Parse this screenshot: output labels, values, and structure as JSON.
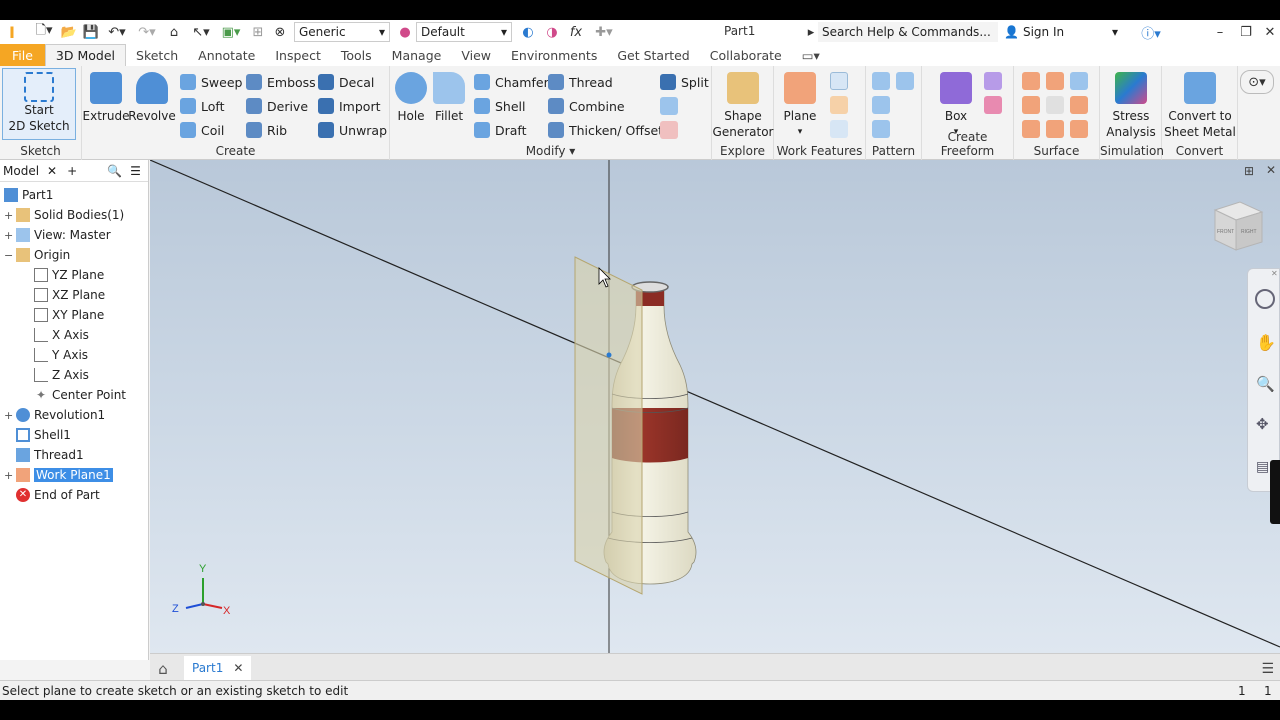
{
  "quick_access": {
    "material_value": "Generic",
    "appearance_value": "Default",
    "document_title": "Part1",
    "search_placeholder": "Search Help & Commands...",
    "sign_in": "Sign In"
  },
  "menu_tabs": [
    "File",
    "3D Model",
    "Sketch",
    "Annotate",
    "Inspect",
    "Tools",
    "Manage",
    "View",
    "Environments",
    "Get Started",
    "Collaborate"
  ],
  "ribbon": {
    "sketch": {
      "start": "Start",
      "start2": "2D Sketch",
      "title": "Sketch"
    },
    "create": {
      "title": "Create",
      "extrude": "Extrude",
      "revolve": "Revolve",
      "sweep": "Sweep",
      "loft": "Loft",
      "coil": "Coil",
      "emboss": "Emboss",
      "derive": "Derive",
      "rib": "Rib",
      "decal": "Decal",
      "import": "Import",
      "unwrap": "Unwrap"
    },
    "modify": {
      "title": "Modify",
      "hole": "Hole",
      "fillet": "Fillet",
      "chamfer": "Chamfer",
      "shell": "Shell",
      "draft": "Draft",
      "thread": "Thread",
      "combine": "Combine",
      "thicken": "Thicken/ Offset",
      "split": "Split"
    },
    "explore": {
      "title": "Explore",
      "shape1": "Shape",
      "shape2": "Generator"
    },
    "work_features": {
      "title": "Work Features",
      "plane": "Plane"
    },
    "pattern": {
      "title": "Pattern"
    },
    "freeform": {
      "title": "Create Freeform",
      "box": "Box"
    },
    "surface": {
      "title": "Surface"
    },
    "simulation": {
      "title": "Simulation",
      "stress1": "Stress",
      "stress2": "Analysis"
    },
    "convert": {
      "title": "Convert",
      "c1": "Convert to",
      "c2": "Sheet Metal"
    }
  },
  "browser": {
    "tab_label": "Model",
    "tree": {
      "part": "Part1",
      "solid_bodies": "Solid Bodies(1)",
      "view": "View: Master",
      "origin": "Origin",
      "yz": "YZ Plane",
      "xz": "XZ Plane",
      "xy": "XY Plane",
      "xaxis": "X Axis",
      "yaxis": "Y Axis",
      "zaxis": "Z Axis",
      "center": "Center Point",
      "revolution": "Revolution1",
      "shell": "Shell1",
      "thread": "Thread1",
      "workplane": "Work Plane1",
      "end": "End of Part"
    }
  },
  "viewcube": {
    "front": "FRONT",
    "right": "RIGHT"
  },
  "triad": {
    "x": "X",
    "y": "Y",
    "z": "Z"
  },
  "doc_tab": "Part1",
  "status": {
    "message": "Select plane to create sketch or an existing sketch to edit",
    "count1": "1",
    "count2": "1"
  },
  "colors": {
    "file_tab": "#f5a623",
    "selection": "#3d8ee6",
    "bottle_label": "#8b2c24",
    "bottle_body": "#efeee0",
    "work_plane": "#d9d2ac"
  }
}
